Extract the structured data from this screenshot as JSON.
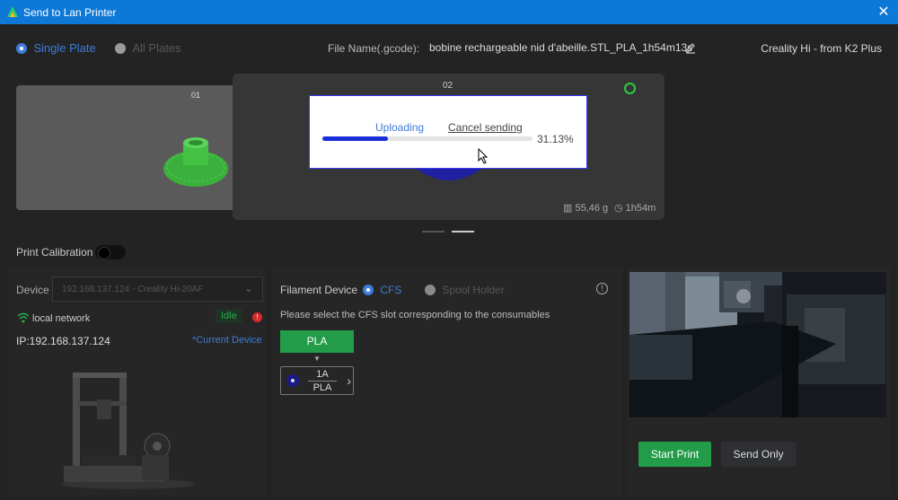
{
  "window": {
    "title": "Send to Lan Printer"
  },
  "top": {
    "single_plate": "Single Plate",
    "all_plates": "All Plates",
    "file_name_label": "File Name(.gcode):",
    "file_name_value": "bobine rechargeable nid d'abeille.STL_PLA_1h54m13s",
    "printer_preset": "Creality Hi - from K2 Plus"
  },
  "plates": [
    {
      "id": "01"
    },
    {
      "id": "02",
      "weight": "55,46 g",
      "time": "1h54m"
    }
  ],
  "upload_dialog": {
    "status": "Uploading",
    "cancel_label": "Cancel sending",
    "progress_text": "31.13%",
    "progress": 0.3113
  },
  "calibration": {
    "label": "Print Calibration",
    "enabled": false
  },
  "device": {
    "label": "Device",
    "selected": "192.168.137.124 - Creality Hi-20AF",
    "network": "local network",
    "status": "Idle",
    "ip": "IP:192.168.137.124",
    "current_device": "*Current Device"
  },
  "filament": {
    "label": "Filament Device",
    "cfs": "CFS",
    "spool_holder": "Spool Holder",
    "instruction": "Please select the CFS slot corresponding to the consumables",
    "material": "PLA",
    "slot_id": "1A",
    "slot_material": "PLA"
  },
  "actions": {
    "start_print": "Start Print",
    "send_only": "Send Only"
  },
  "colors": {
    "accent": "#3d7bd9",
    "green": "#229c49",
    "titlebar": "#0e78d7"
  }
}
